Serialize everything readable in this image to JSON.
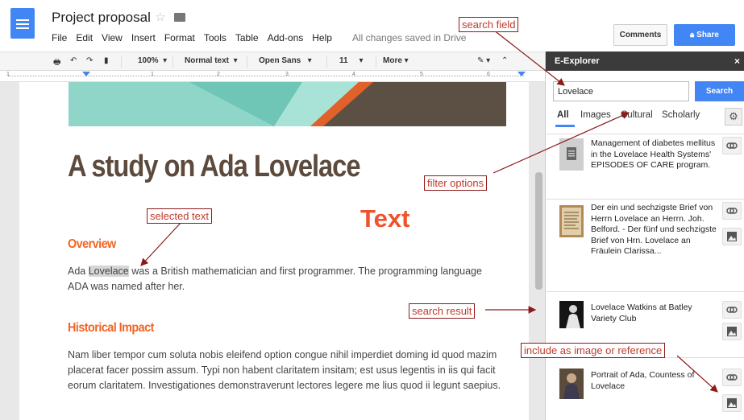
{
  "document": {
    "title": "Project proposal",
    "menu": [
      "File",
      "Edit",
      "View",
      "Insert",
      "Format",
      "Tools",
      "Table",
      "Add-ons",
      "Help"
    ],
    "save_status": "All changes saved in Drive",
    "comments_label": "Comments",
    "share_label": "Share",
    "toolbar": {
      "zoom": "100%",
      "style": "Normal text",
      "font": "Open Sans",
      "size": "11",
      "more": "More"
    },
    "ruler_numbers": [
      "1",
      "1",
      "2",
      "3",
      "4",
      "5",
      "6"
    ],
    "heading": "A study on Ada Lovelace",
    "overview_heading": "Overview",
    "overview_pre": "Ada ",
    "overview_highlight": "Lovelace",
    "overview_post": " was a British mathematician and first programmer. The programming language ADA was named after her.",
    "impact_heading": "Historical Impact",
    "impact_text": "Nam liber tempor cum soluta nobis eleifend option congue nihil imperdiet doming id quod mazim placerat facer possim assum. Typi non habent claritatem insitam; est usus legentis in iis qui facit eorum claritatem. Investigationes demonstraverunt lectores legere me lius quod ii legunt saepius."
  },
  "panel": {
    "title": "E-Explorer",
    "close": "×",
    "search_value": "Lovelace",
    "search_button": "Search",
    "tabs": [
      "All",
      "Images",
      "Cultural",
      "Scholarly"
    ],
    "results": [
      {
        "text": "Management of diabetes mellitus in the Lovelace Health Systems' EPISODES OF CARE program."
      },
      {
        "text": "Der ein und sechzigste Brief von Herrn Lovelace an Herrn. Joh. Belford. - Der fünf und sechzigste Brief von Hrn. Lovelace an Fräulein Clarissa..."
      },
      {
        "text": "Lovelace Watkins at Batley Variety Club"
      },
      {
        "text": "Portrait of Ada, Countess of Lovelace"
      }
    ]
  },
  "annotations": {
    "search_field": "search field",
    "filter_options": "filter options",
    "selected_text": "selected text",
    "text_label": "Text",
    "search_result": "search result",
    "include": "include as image or reference"
  },
  "colors": {
    "accent": "#4285f4",
    "annotation": "#c0392b",
    "heading": "#5c4a3d",
    "subheading": "#f26522"
  }
}
